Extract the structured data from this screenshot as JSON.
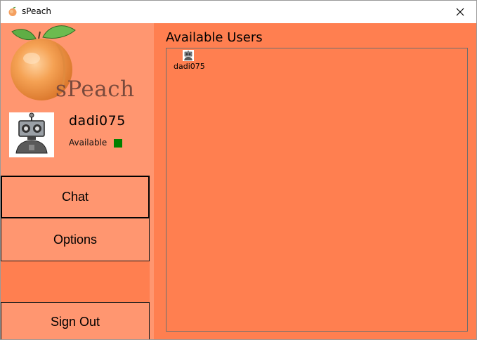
{
  "window": {
    "title": "sPeach",
    "close_glyph": "✕"
  },
  "sidebar": {
    "logo_text": "sPeach",
    "profile": {
      "username": "dadi075",
      "status_label": "Available",
      "status_color": "#008000",
      "avatar_icon": "robot-avatar-icon"
    },
    "nav": {
      "chat_label": "Chat",
      "options_label": "Options",
      "signout_label": "Sign Out"
    }
  },
  "main": {
    "title": "Available Users",
    "users": [
      {
        "name": "dadi075",
        "icon": "robot-avatar-icon"
      }
    ]
  },
  "colors": {
    "sidebar_bg": "#ff9670",
    "main_bg": "#ff7f50",
    "status_available": "#008000"
  }
}
